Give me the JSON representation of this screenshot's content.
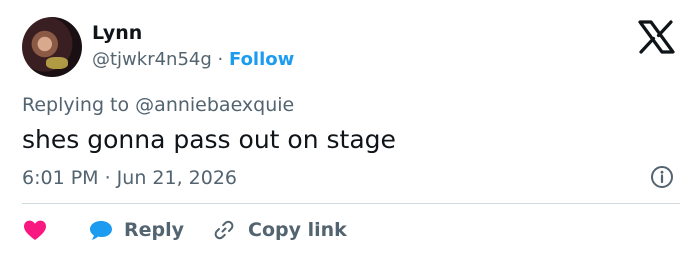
{
  "author": {
    "name": "Lynn",
    "handle": "@tjwkr4n54g",
    "separator": "·",
    "follow_label": "Follow"
  },
  "reply_context": {
    "prefix": "Replying to",
    "target": "@anniebaexquie"
  },
  "tweet": {
    "text": "shes gonna pass out on stage",
    "timestamp": "6:01 PM · Jun 21, 2026"
  },
  "actions": {
    "reply_label": "Reply",
    "copy_link_label": "Copy link"
  },
  "icons": {
    "logo": "x-logo-icon",
    "info": "info-icon",
    "like": "heart-icon",
    "reply": "reply-bubble-icon",
    "link": "link-icon"
  },
  "colors": {
    "like": "#f91880",
    "reply": "#1d9bf0",
    "follow": "#1d9bf0",
    "muted": "#536471"
  }
}
